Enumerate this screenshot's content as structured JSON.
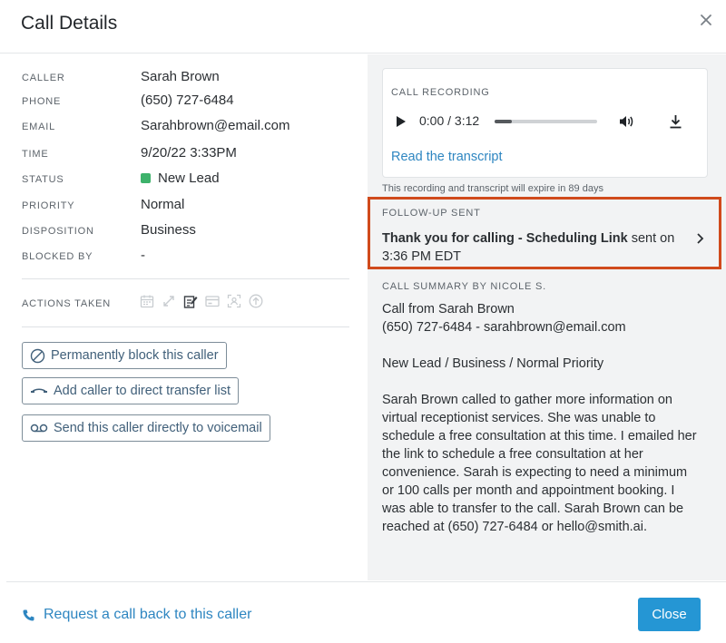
{
  "dialog": {
    "title": "Call Details"
  },
  "details": [
    {
      "label": "CALLER",
      "value": "Sarah Brown"
    },
    {
      "label": "PHONE",
      "value": "(650) 727-6484"
    },
    {
      "label": "EMAIL",
      "value": "Sarahbrown@email.com"
    },
    {
      "label": "TIME",
      "value": "9/20/22 3:33PM"
    },
    {
      "label": "STATUS",
      "value": "New Lead"
    },
    {
      "label": "PRIORITY",
      "value": "Normal"
    },
    {
      "label": "DISPOSITION",
      "value": "Business"
    },
    {
      "label": "BLOCKED BY",
      "value": "-"
    }
  ],
  "actions": {
    "label": "ACTIONS TAKEN",
    "icons": [
      "calendar-icon",
      "transfer-icon",
      "note-edit-icon",
      "payment-card-icon",
      "contact-scan-icon",
      "upload-circle-icon"
    ]
  },
  "buttons": {
    "block": "Permanently block this caller",
    "transfer": "Add caller to direct transfer list",
    "voicemail": "Send this caller directly to voicemail"
  },
  "recording": {
    "label": "CALL RECORDING",
    "time": "0:00 / 3:12",
    "progress": 0.17,
    "transcript_link": "Read the transcript",
    "expire_note": "This recording and transcript will expire in 89 days"
  },
  "followup": {
    "label": "FOLLOW-UP SENT",
    "bold": "Thank you for calling - Scheduling Link",
    "rest": " sent on 3:36 PM EDT"
  },
  "summary": {
    "label": "CALL SUMMARY BY NICOLE S.",
    "line1": "Call from Sarah Brown",
    "line2": "(650) 727-6484 - sarahbrown@email.com",
    "line3": "New Lead / Business / Normal Priority",
    "paragraph": "Sarah Brown called to gather more information on virtual receptionist services. She was unable to schedule a free consultation at this time. I emailed her the link to schedule a free consultation at her convenience. Sarah is expecting to need a minimum or 100 calls per month and appointment booking. I was able to transfer to the call. Sarah Brown can be reached at (650) 727-6484 or hello@smith.ai."
  },
  "footer": {
    "callback": "Request a call back to this caller",
    "close": "Close"
  },
  "colors": {
    "accent": "#2e86c1",
    "status_green": "#3db26b",
    "highlight_border": "#d04a1c",
    "primary_button": "#2596d4"
  }
}
